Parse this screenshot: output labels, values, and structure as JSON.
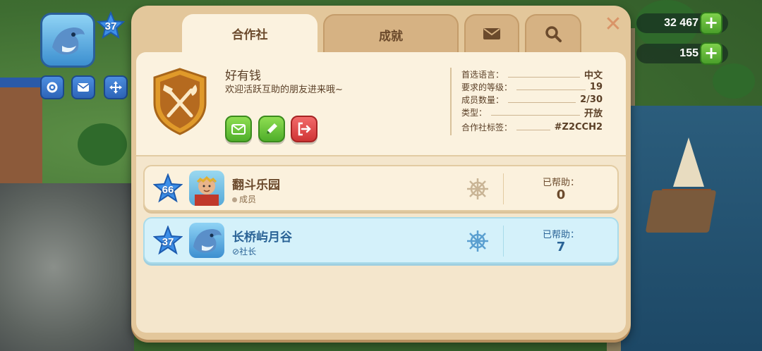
{
  "hud": {
    "level": "37",
    "currency_1": "32 467",
    "currency_2": "155",
    "plus_label": "+"
  },
  "tabs": {
    "coop": "合作社",
    "achievements": "成就",
    "mail_icon": "envelope-icon",
    "search_icon": "magnifier-icon"
  },
  "close_label": "✕",
  "coop": {
    "name": "好有钱",
    "description": "欢迎活跃互助的朋友进来哦~",
    "crest_icon": "fork-shovel-crest-icon",
    "info": [
      {
        "label": "首选语言：",
        "value": "中文"
      },
      {
        "label": "要求的等级：",
        "value": "19"
      },
      {
        "label": "成员数量：",
        "value": "2/30"
      },
      {
        "label": "类型：",
        "value": "开放"
      },
      {
        "label": "合作社标签：",
        "value": "#Z2CCH2"
      }
    ]
  },
  "members": [
    {
      "level": "66",
      "name": "翻斗乐园",
      "role": "成员",
      "help_label": "已帮助：",
      "help_value": "0"
    },
    {
      "level": "37",
      "name": "长桥屿月谷",
      "role": "社长",
      "help_label": "已帮助：",
      "help_value": "7"
    }
  ],
  "colors": {
    "panel": "#e3c79b",
    "panel_inner": "#fbf2df",
    "highlight_row": "#d4f1fa",
    "green_button": "#4fae2a",
    "red_button": "#cf3535",
    "star_blue": "#3d8fe8"
  }
}
